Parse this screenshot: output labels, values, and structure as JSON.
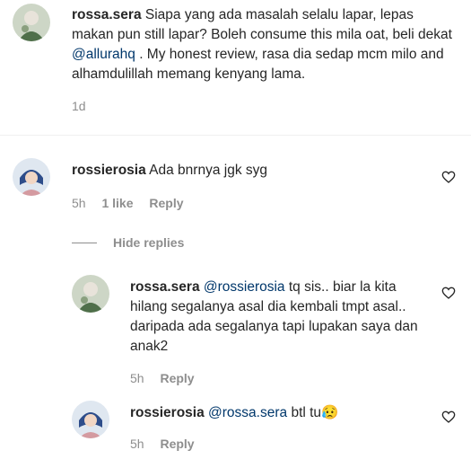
{
  "comments": [
    {
      "username": "rossa.sera",
      "text": "Siapa yang ada masalah selalu lapar, lepas makan pun still lapar? Boleh consume this mila oat, beli dekat ",
      "mention": "@allurahq",
      "text_after": " . My honest review, rasa dia sedap mcm milo and alhamdulillah memang kenyang lama.",
      "time": "1d"
    },
    {
      "username": "rossierosia",
      "text": "Ada bnrnya jgk syg",
      "time": "5h",
      "likes": "1 like",
      "reply_label": "Reply",
      "hide_replies_label": "Hide replies",
      "replies": [
        {
          "username": "rossa.sera",
          "mention": "@rossierosia",
          "text": " tq sis.. biar la kita hilang segalanya asal dia kembali tmpt asal.. daripada ada segalanya tapi lupakan saya dan anak2",
          "time": "5h",
          "reply_label": "Reply"
        },
        {
          "username": "rossierosia",
          "mention": "@rossa.sera",
          "text": " btl tu",
          "emoji": "😥",
          "time": "5h",
          "reply_label": "Reply"
        }
      ]
    }
  ],
  "icons": {
    "like": "heart-outline-icon"
  },
  "colors": {
    "mention": "#00376b",
    "meta": "#8e8e8e",
    "text": "#262626"
  }
}
